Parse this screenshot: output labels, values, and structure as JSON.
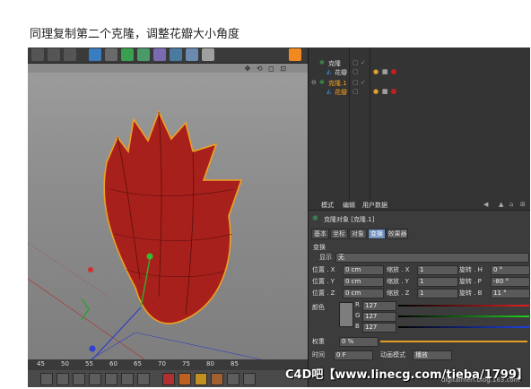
{
  "caption": "同理复制第二个克隆，调整花瓣大小角度",
  "object_manager": {
    "rows": [
      {
        "label": "克隆",
        "color": "#dddddd"
      },
      {
        "label": "花瓣",
        "color": "#dddddd"
      },
      {
        "label": "克隆.1",
        "color": "#f0a020"
      },
      {
        "label": "花瓣",
        "color": "#f0a020"
      }
    ]
  },
  "attributes": {
    "menu": [
      "模式",
      "编辑",
      "用户数据"
    ],
    "object_title": "克隆对象 [克隆.1]",
    "tabs": [
      "基本",
      "坐标",
      "对象",
      "变换",
      "效果器"
    ],
    "active_tab": "变换",
    "section": "变换",
    "display_label": "显示",
    "display_value": "无",
    "rows": [
      {
        "pos_label": "位置 . X",
        "pos_value": "0 cm",
        "scale_label": "缩放 . X",
        "scale_value": "1",
        "rot_label": "旋转 . H",
        "rot_value": "0 °"
      },
      {
        "pos_label": "位置 . Y",
        "pos_value": "0 cm",
        "scale_label": "缩放 . Y",
        "scale_value": "1",
        "rot_label": "旋转 . P",
        "rot_value": "-80 °"
      },
      {
        "pos_label": "位置 . Z",
        "pos_value": "0 cm",
        "scale_label": "缩放 . Z",
        "scale_value": "1",
        "rot_label": "旋转 . B",
        "rot_value": "11 °"
      }
    ],
    "color_label": "颜色",
    "rgb": [
      {
        "label": "R",
        "value": "127",
        "color": "#d03030"
      },
      {
        "label": "G",
        "value": "127",
        "color": "#30b030"
      },
      {
        "label": "B",
        "value": "127",
        "color": "#3050d0"
      }
    ],
    "weight_label": "权重",
    "weight_value": "0 %",
    "time_label": "时间",
    "time_value": "0 F",
    "anim_label": "动画模式",
    "anim_value": "播放"
  },
  "timeline": {
    "ticks": [
      "45",
      "50",
      "55",
      "60",
      "65",
      "70",
      "75",
      "80",
      "85"
    ]
  },
  "watermark": "C4D吧【www.linecg.com/tieba/1799】",
  "site": "digitalmen.blog.163.com"
}
